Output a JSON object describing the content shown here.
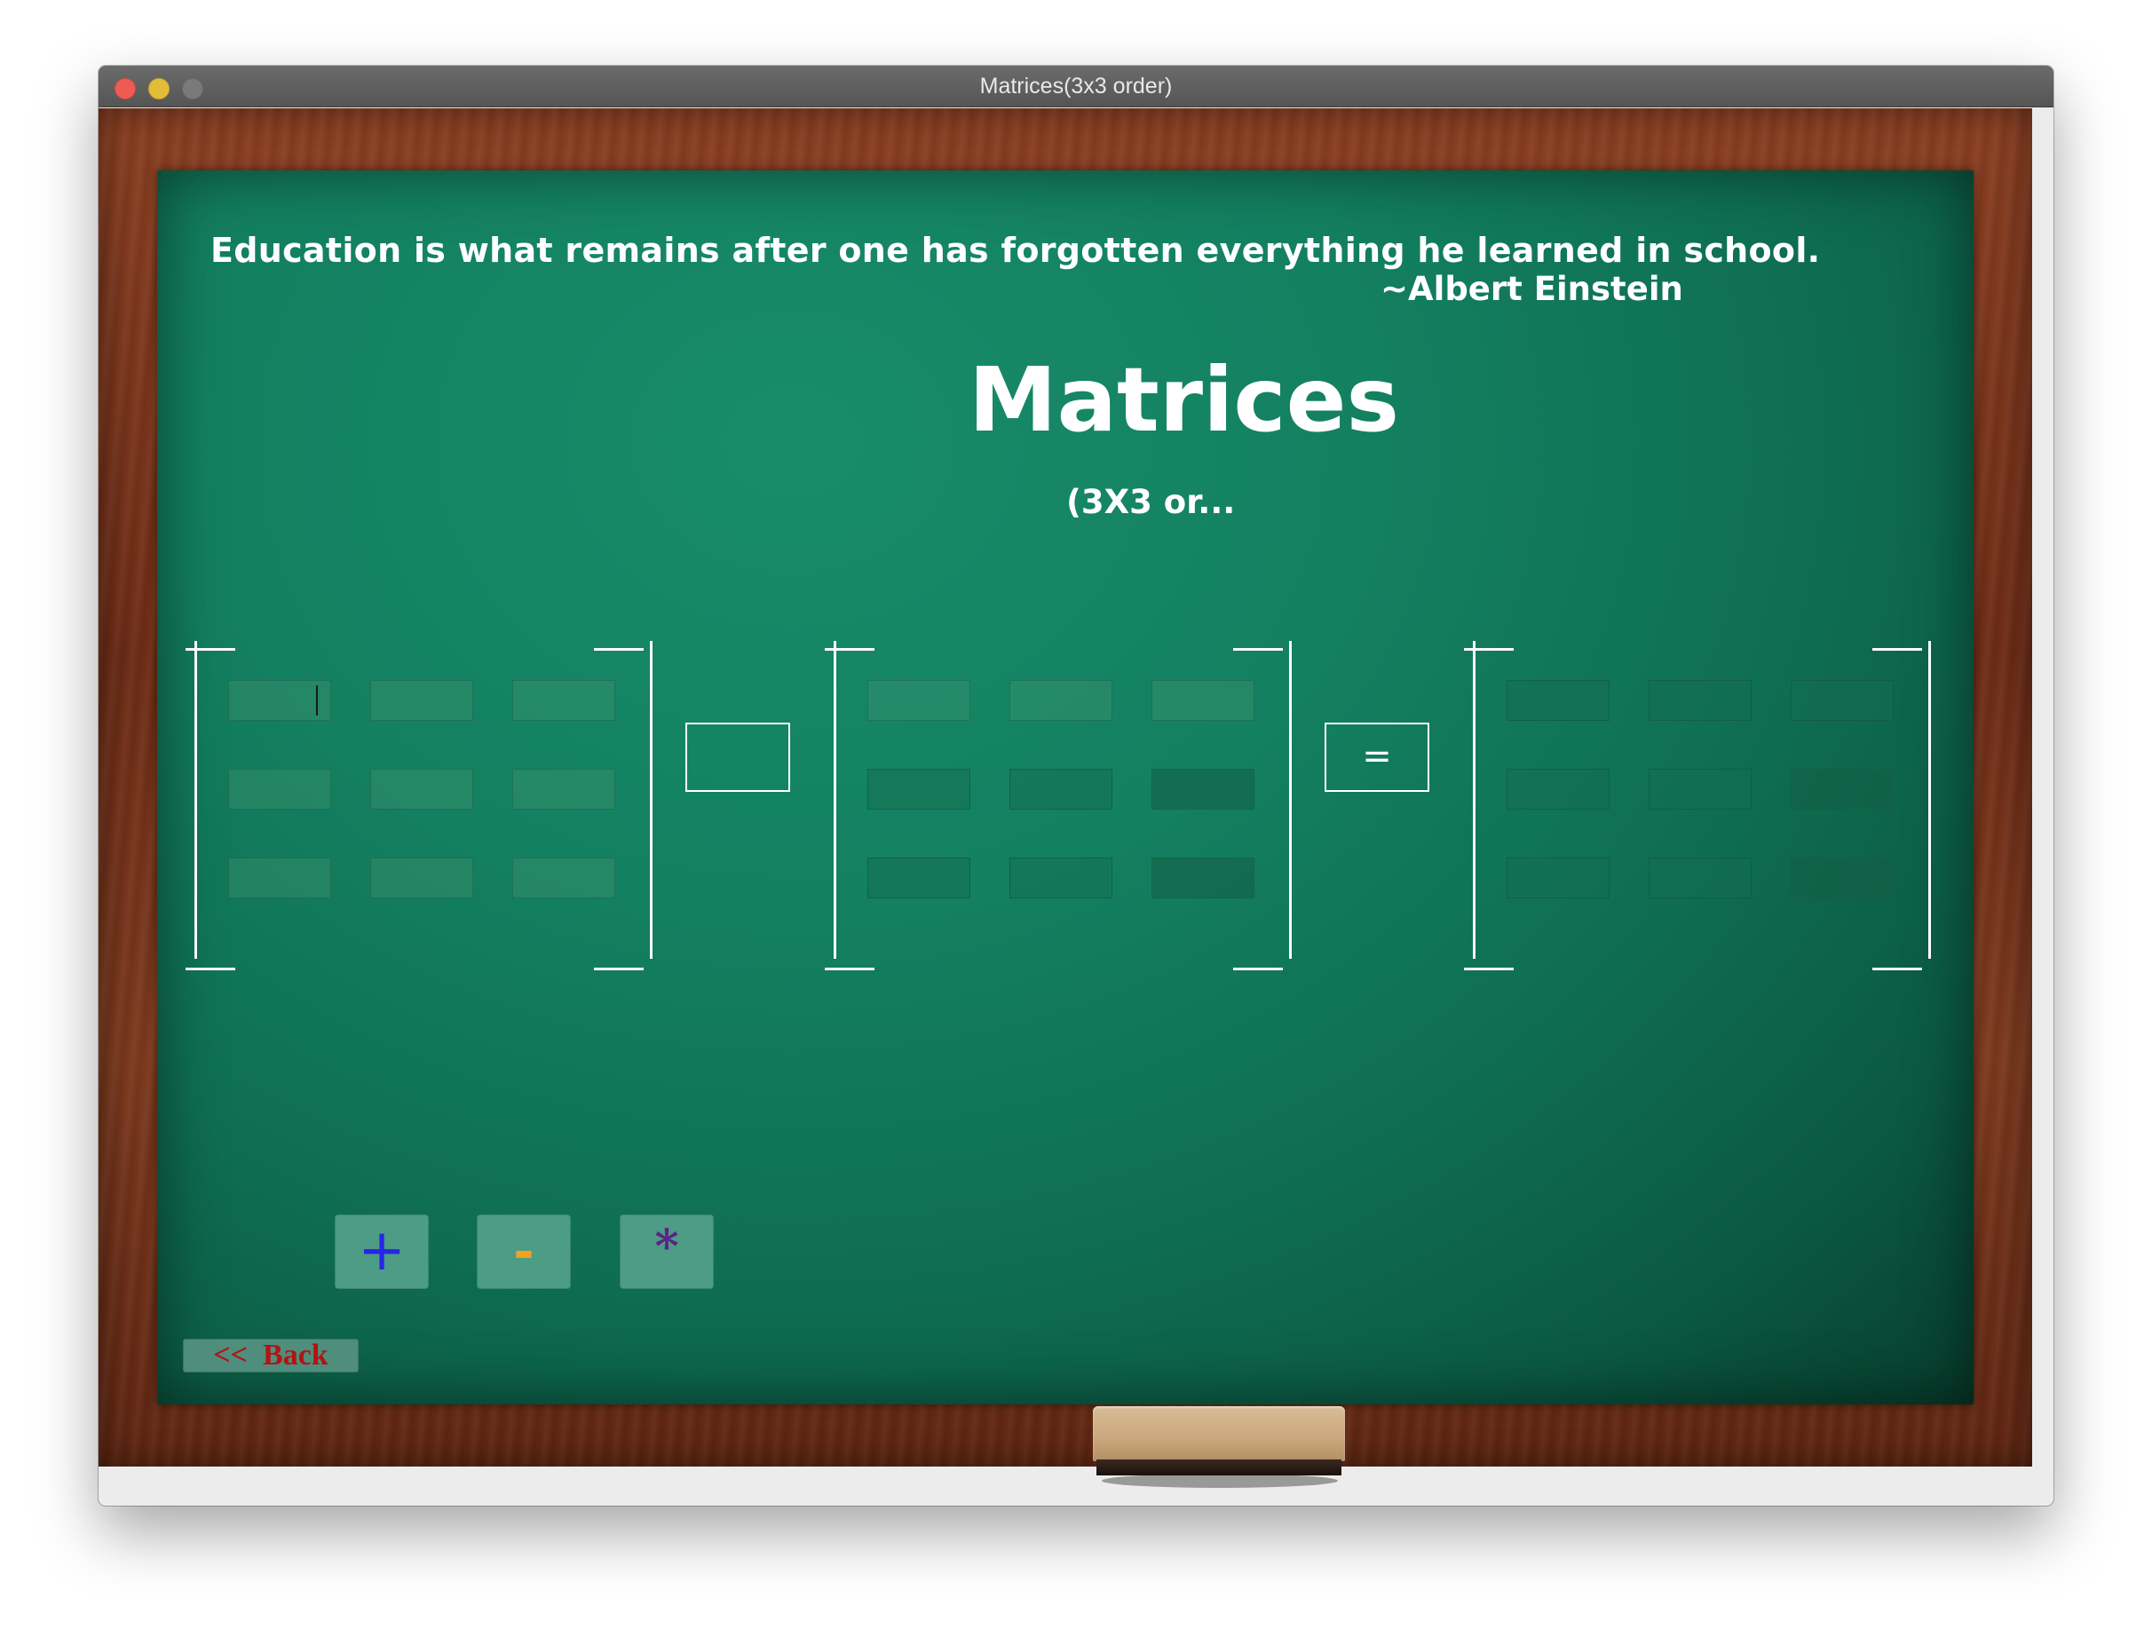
{
  "window": {
    "title": "Matrices(3x3 order)"
  },
  "board": {
    "quote": "Education is what remains after one has forgotten everything he learned in school.",
    "author": "~Albert Einstein",
    "title": "Matrices",
    "subtitle": "(3X3 or..."
  },
  "matrix_a": {
    "cells": [
      "",
      "",
      "",
      "",
      "",
      "",
      "",
      "",
      ""
    ]
  },
  "matrix_b": {
    "cells": [
      "",
      "",
      "",
      "",
      "",
      "",
      "",
      "",
      ""
    ]
  },
  "matrix_result": {
    "cells": [
      "",
      "",
      "",
      "",
      "",
      "",
      "",
      "",
      ""
    ]
  },
  "operator_display": "",
  "equals_sign": "=",
  "buttons": {
    "add": "+",
    "subtract": "-",
    "multiply": "*",
    "back": "<<  Back"
  },
  "colors": {
    "board": "#138060",
    "frame": "#7a3a20",
    "add": "#2626e6",
    "subtract": "#f2a21c",
    "multiply": "#5b2384",
    "back": "#b31313"
  }
}
